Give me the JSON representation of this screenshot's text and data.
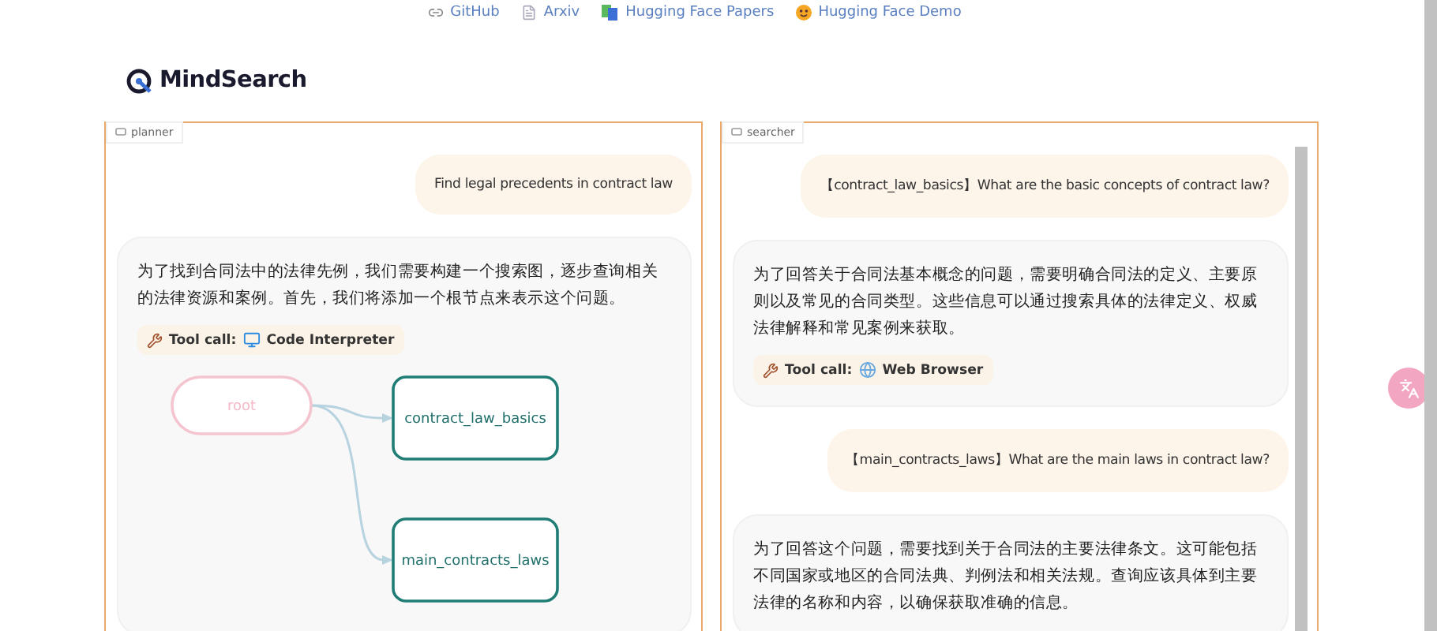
{
  "links": [
    {
      "kind": "github",
      "label": "GitHub"
    },
    {
      "kind": "arxiv",
      "label": "Arxiv"
    },
    {
      "kind": "papers",
      "label": "Hugging Face Papers"
    },
    {
      "kind": "demo",
      "label": "Hugging Face Demo"
    }
  ],
  "logo": {
    "text": "MindSearch"
  },
  "panels": [
    {
      "label": "planner",
      "scrollbar": false,
      "messages": [
        {
          "kind": "user",
          "text": "Find legal precedents in contract law"
        },
        {
          "kind": "assistant",
          "text": "为了找到合同法中的法律先例，我们需要构建一个搜索图，逐步查询相关的法律资源和案例。首先，我们将添加一个根节点来表示这个问题。",
          "tool_call": {
            "label": "Tool call:",
            "tool": "Code Interpreter",
            "kind": "code"
          },
          "graph": {
            "nodes": [
              {
                "kind": "root",
                "label": "root"
              },
              {
                "kind": "node",
                "label": "contract_law_basics"
              },
              {
                "kind": "node",
                "label": "main_contracts_laws"
              }
            ]
          }
        }
      ]
    },
    {
      "label": "searcher",
      "scrollbar": true,
      "messages": [
        {
          "kind": "user",
          "text": "【contract_law_basics】What are the basic concepts of contract law?"
        },
        {
          "kind": "assistant",
          "text": "为了回答关于合同法基本概念的问题，需要明确合同法的定义、主要原则以及常见的合同类型。这些信息可以通过搜索具体的法律定义、权威法律解释和常见案例来获取。",
          "tool_call": {
            "label": "Tool call:",
            "tool": "Web Browser",
            "kind": "web"
          }
        },
        {
          "kind": "user",
          "text": "【main_contracts_laws】What are the main laws in contract law?"
        },
        {
          "kind": "assistant",
          "text": "为了回答这个问题，需要找到关于合同法的主要法律条文。这可能包括不同国家或地区的合同法典、判例法和相关法规。查询应该具体到主要法律的名称和内容，以确保获取准确的信息。"
        }
      ]
    }
  ]
}
